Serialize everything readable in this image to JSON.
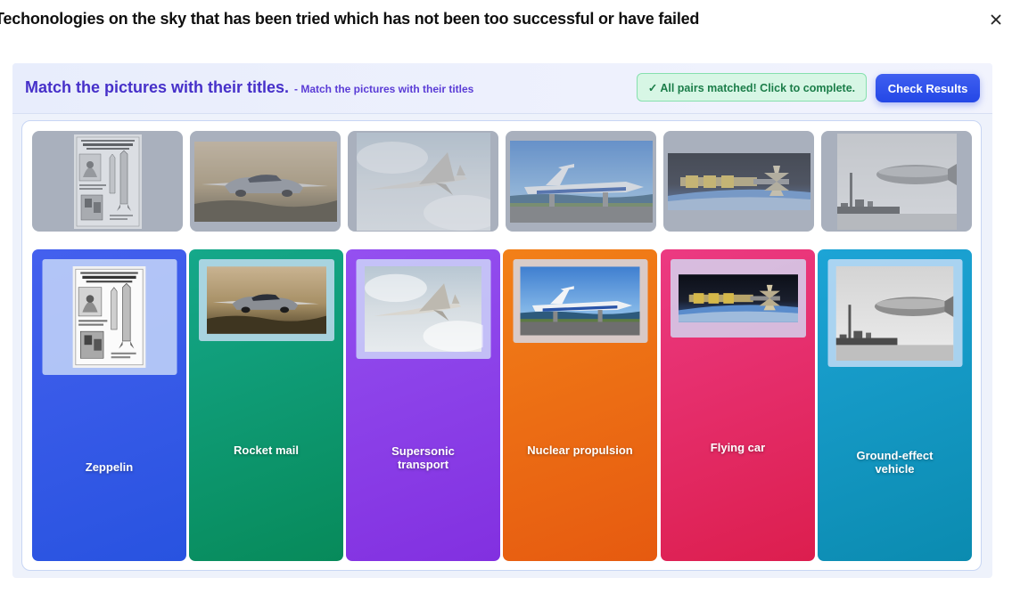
{
  "modal": {
    "title": "Techonologies on the sky that has been tried which has not been too successful or have failed",
    "close_label": "✕"
  },
  "activity": {
    "heading": "Match the pictures with their titles.",
    "subheading": "- Match the pictures with their titles",
    "status": "✓ All pairs matched! Click to complete.",
    "check_button": "Check Results"
  },
  "tiles": [
    {
      "image": "rocket-mail-poster-image"
    },
    {
      "image": "flying-car-image"
    },
    {
      "image": "supersonic-jet-image"
    },
    {
      "image": "ground-effect-vehicle-image"
    },
    {
      "image": "nuclear-spacecraft-image"
    },
    {
      "image": "zeppelin-image"
    }
  ],
  "cards": [
    {
      "label": "Zeppelin",
      "image": "rocket-mail-poster-image",
      "color_from": "#4460ee",
      "color_to": "#2853e0"
    },
    {
      "label": "Rocket mail",
      "image": "flying-car-image",
      "color_from": "#15a88a",
      "color_to": "#078a5a"
    },
    {
      "label": "Supersonic transport",
      "image": "supersonic-jet-image",
      "color_from": "#9450f0",
      "color_to": "#8230e0"
    },
    {
      "label": "Nuclear propulsion",
      "image": "ground-effect-vehicle-image",
      "color_from": "#f28018",
      "color_to": "#e65a10"
    },
    {
      "label": "Flying car",
      "image": "nuclear-spacecraft-image",
      "color_from": "#ec3a82",
      "color_to": "#dc1e4e"
    },
    {
      "label": "Ground-effect vehicle",
      "image": "zeppelin-image",
      "color_from": "#1da4d6",
      "color_to": "#0b8bb0"
    }
  ]
}
